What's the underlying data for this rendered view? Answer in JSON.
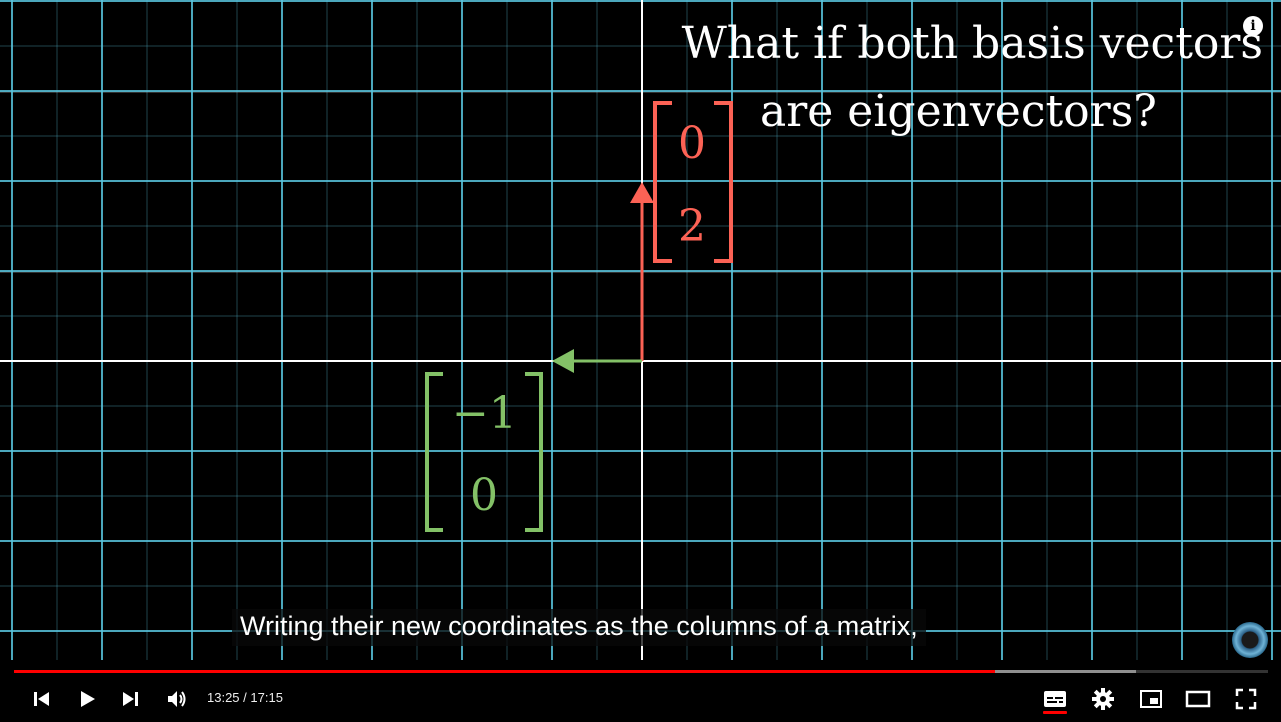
{
  "video": {
    "title_line_1": "What if both basis vectors",
    "title_line_2": "are eigenvectors?",
    "red_vector": {
      "entries": [
        "0",
        "2"
      ],
      "color": "#fc6255"
    },
    "green_vector": {
      "entries": [
        "−1",
        "0"
      ],
      "color": "#83c167"
    },
    "grid_color": "#58c4dd",
    "axis_color": "#ffffff"
  },
  "caption": {
    "text": "Writing their new coordinates as the columns of a matrix,"
  },
  "player": {
    "info_icon": "i",
    "progress": {
      "played": 0.782,
      "buffered": 0.895,
      "played_color": "#ff0000"
    },
    "time": {
      "current": "13:25",
      "separator": " / ",
      "duration": "17:15"
    },
    "controls": {
      "previous": "skip-previous-icon",
      "play": "play-icon",
      "next": "skip-next-icon",
      "volume": "volume-icon",
      "subtitles": "subtitles-icon",
      "settings": "gear-icon",
      "miniplayer": "miniplayer-icon",
      "theater": "theater-mode-icon",
      "fullscreen": "fullscreen-icon"
    }
  }
}
